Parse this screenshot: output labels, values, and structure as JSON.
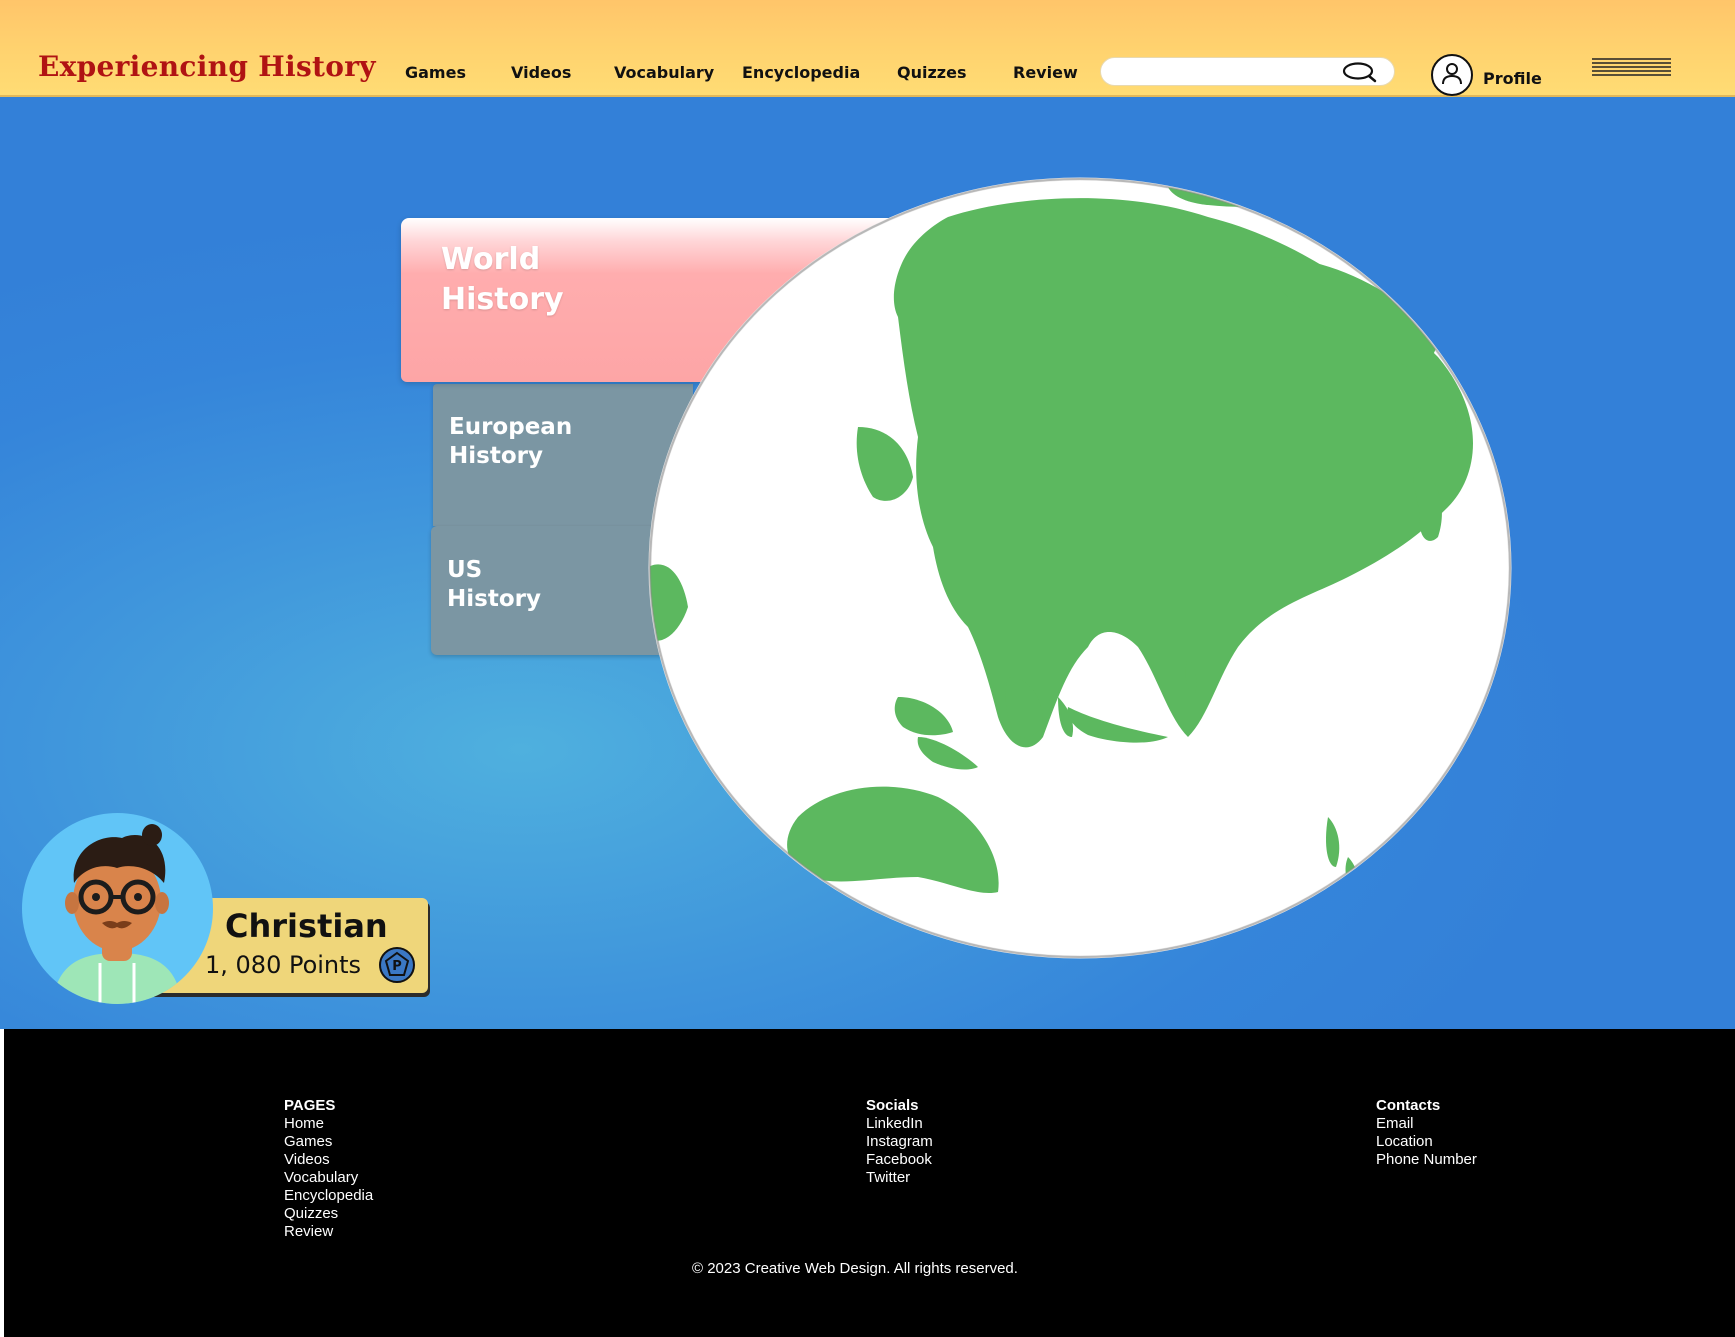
{
  "header": {
    "brand": "Experiencing History",
    "nav": [
      "Games",
      "Videos",
      "Vocabulary",
      "Encyclopedia",
      "Quizzes",
      "Review"
    ],
    "search": {
      "placeholder": "",
      "value": ""
    },
    "profile_label": "Profile",
    "icons": {
      "search": "search-icon",
      "profile": "user-icon",
      "menu": "hamburger-icon"
    }
  },
  "hero": {
    "tabs": [
      {
        "line1": "World",
        "line2": "History",
        "color": "#fda5a6",
        "active": true
      },
      {
        "line1": "European",
        "line2": "History",
        "color": "#7b96a3",
        "active": false
      },
      {
        "line1": "US",
        "line2": "History",
        "color": "#7b96a3",
        "active": false
      }
    ],
    "globe": {
      "land_color": "#5cb85f",
      "ocean_color": "#ffffff"
    },
    "user": {
      "name": "Christian",
      "points": "1, 080 Points",
      "badge": "P"
    }
  },
  "footer": {
    "pages": {
      "title": "PAGES",
      "links": [
        "Home",
        "Games",
        "Videos",
        "Vocabulary",
        "Encyclopedia",
        "Quizzes",
        "Review"
      ]
    },
    "socials": {
      "title": "Socials",
      "links": [
        "LinkedIn",
        "Instagram",
        "Facebook",
        "Twitter"
      ]
    },
    "contacts": {
      "title": "Contacts",
      "links": [
        "Email",
        "Location",
        "Phone Number"
      ]
    },
    "copyright": "© 2023 Creative Web Design. All rights reserved."
  },
  "colors": {
    "header_bg": "#ffd36f",
    "brand": "#b01313",
    "hero_bg": "#3585da",
    "footer_bg": "#000000",
    "card_bg": "#efd67a"
  }
}
